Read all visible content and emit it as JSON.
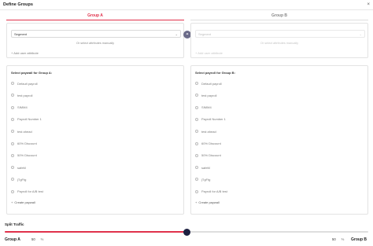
{
  "dialog": {
    "title": "Define Groups",
    "close_glyph": "×"
  },
  "groups": [
    {
      "name": "Group A",
      "segment": {
        "select_value": "Segment",
        "or_text": "Or select attributes manually",
        "add_attribute": "+ Add user attribute",
        "disabled": false
      },
      "payload_heading": "Select paywall for Group A:",
      "options": [
        "Default payroll",
        "test payroll",
        "SIMM4",
        "Payroll Number 1",
        "test ahead",
        "60% Discount",
        "50% Discount",
        "safeM",
        "jTgFtg",
        "Payroll for A/B test"
      ],
      "create_label": "Create paywall"
    },
    {
      "name": "Group B",
      "segment": {
        "select_value": "Segment",
        "or_text": "Or select attributes manually",
        "add_attribute": "+ Add user attribute",
        "disabled": true
      },
      "payload_heading": "Select payroll for Group B:",
      "options": [
        "Default payroll",
        "test payroll",
        "SIMM4",
        "Payroll Number 1",
        "test ahead",
        "60% Discount",
        "50% Discount",
        "safeM",
        "jTgFtg",
        "Payroll for A/B test"
      ],
      "create_label": "Create paywall"
    }
  ],
  "split": {
    "title": "Split Traffic",
    "group_a_label": "Group A",
    "group_b_label": "Group B",
    "group_a_percent": "50",
    "group_b_percent": "50",
    "unit": "%",
    "slider_value": 0.5
  },
  "colors": {
    "accent": "#e0314b",
    "thumb": "#1d2040"
  },
  "icons": {
    "link": "link-icon",
    "chevron": "chevron-down-icon",
    "close": "close-icon"
  }
}
